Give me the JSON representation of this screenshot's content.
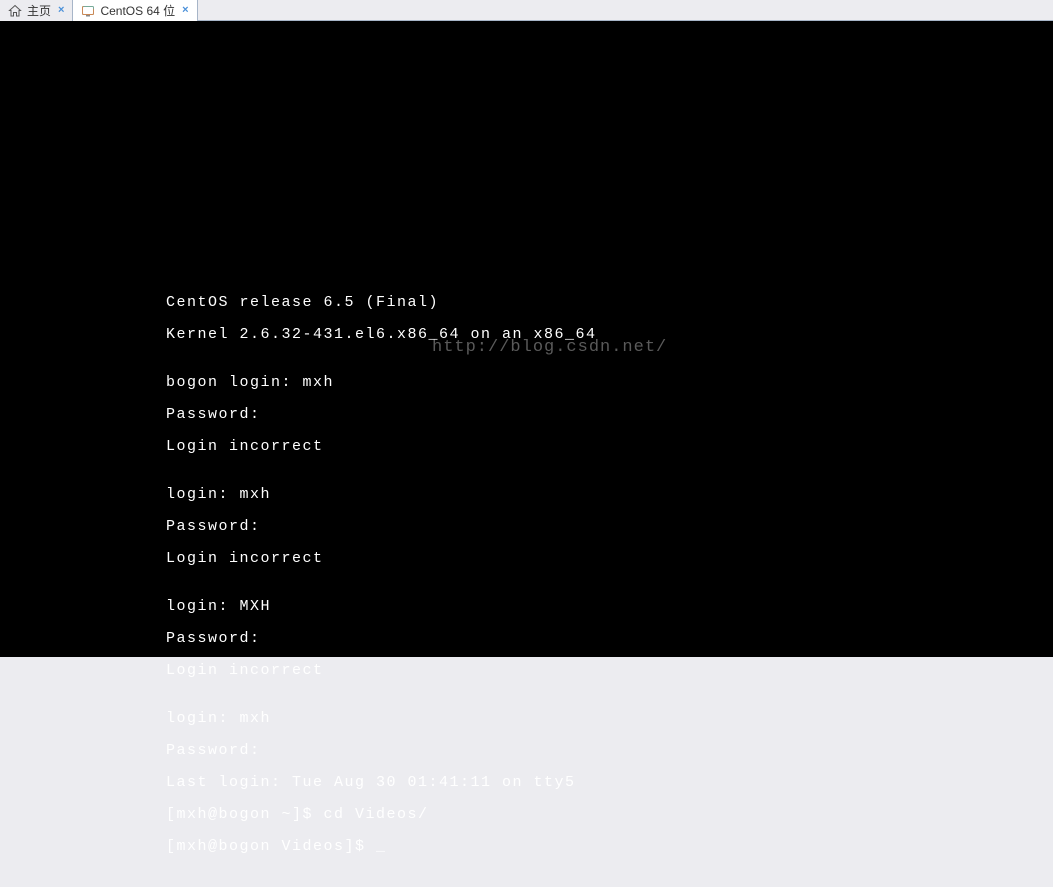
{
  "tabs": {
    "home": {
      "label": "主页"
    },
    "vm": {
      "label": "CentOS 64 位"
    }
  },
  "terminal": {
    "l0": "CentOS release 6.5 (Final)",
    "l1": "Kernel 2.6.32-431.el6.x86_64 on an x86_64",
    "l2": "",
    "l3": "bogon login: mxh",
    "l4": "Password:",
    "l5": "Login incorrect",
    "l6": "",
    "l7": "login: mxh",
    "l8": "Password:",
    "l9": "Login incorrect",
    "l10": "",
    "l11": "login: MXH",
    "l12": "Password:",
    "l13": "Login incorrect",
    "l14": "",
    "l15": "login: mxh",
    "l16": "Password:",
    "l17": "Last login: Tue Aug 30 01:41:11 on tty5",
    "l18": "[mxh@bogon ~]$ cd Videos/",
    "l19": "[mxh@bogon Videos]$ ",
    "cursor": "_"
  },
  "watermark": "http://blog.csdn.net/"
}
